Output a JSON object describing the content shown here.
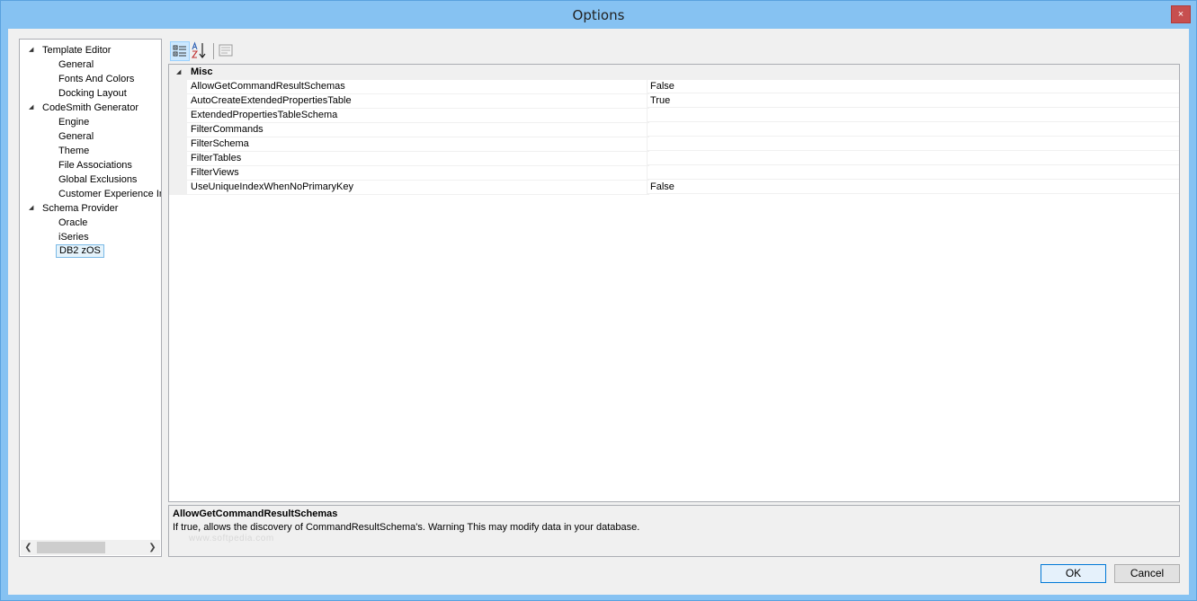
{
  "window": {
    "title": "Options",
    "close_glyph": "×"
  },
  "tree": {
    "nodes": [
      {
        "label": "Template Editor",
        "level": 0,
        "expanded": true
      },
      {
        "label": "General",
        "level": 1
      },
      {
        "label": "Fonts And Colors",
        "level": 1
      },
      {
        "label": "Docking Layout",
        "level": 1
      },
      {
        "label": "CodeSmith Generator",
        "level": 0,
        "expanded": true
      },
      {
        "label": "Engine",
        "level": 1
      },
      {
        "label": "General",
        "level": 1
      },
      {
        "label": "Theme",
        "level": 1
      },
      {
        "label": "File Associations",
        "level": 1
      },
      {
        "label": "Global Exclusions",
        "level": 1
      },
      {
        "label": "Customer Experience Im",
        "level": 1
      },
      {
        "label": "Schema Provider",
        "level": 0,
        "expanded": true
      },
      {
        "label": "Oracle",
        "level": 1
      },
      {
        "label": "iSeries",
        "level": 1
      },
      {
        "label": "DB2 zOS",
        "level": 1,
        "selected": true
      }
    ]
  },
  "toolbar": {
    "categorized_icon": "categorized-view-icon",
    "alphabetical_icon": "sort-alphabetical-icon",
    "property_pages_icon": "property-pages-icon"
  },
  "grid": {
    "category": "Misc",
    "properties": [
      {
        "name": "AllowGetCommandResultSchemas",
        "value": "False"
      },
      {
        "name": "AutoCreateExtendedPropertiesTable",
        "value": "True"
      },
      {
        "name": "ExtendedPropertiesTableSchema",
        "value": ""
      },
      {
        "name": "FilterCommands",
        "value": ""
      },
      {
        "name": "FilterSchema",
        "value": ""
      },
      {
        "name": "FilterTables",
        "value": ""
      },
      {
        "name": "FilterViews",
        "value": ""
      },
      {
        "name": "UseUniqueIndexWhenNoPrimaryKey",
        "value": "False"
      }
    ]
  },
  "description": {
    "title": "AllowGetCommandResultSchemas",
    "text": "If true, allows the discovery of CommandResultSchema's. Warning This may modify data in your database.",
    "watermark": "www.softpedia.com"
  },
  "buttons": {
    "ok": "OK",
    "cancel": "Cancel"
  },
  "colors": {
    "title_bar": "#86c2f2",
    "close_button": "#c74f4f",
    "selection": "#e5f3fb"
  }
}
